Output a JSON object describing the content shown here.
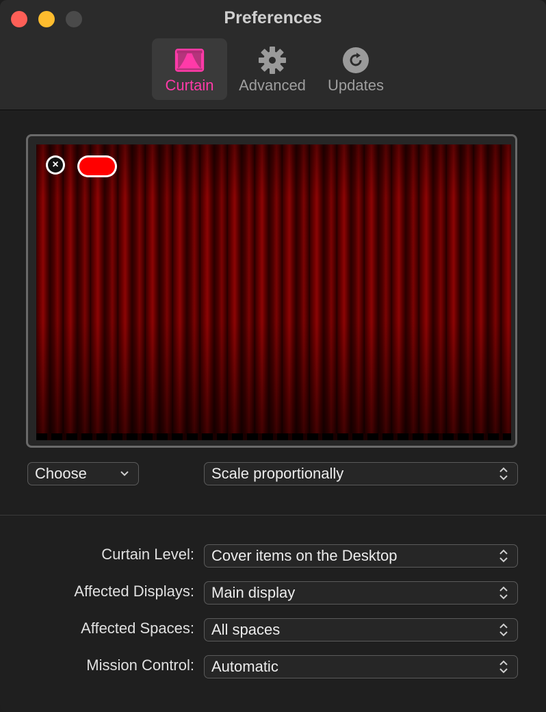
{
  "window": {
    "title": "Preferences"
  },
  "tabs": [
    {
      "label": "Curtain",
      "icon": "curtain-icon",
      "active": true
    },
    {
      "label": "Advanced",
      "icon": "gear-icon",
      "active": false
    },
    {
      "label": "Updates",
      "icon": "refresh-icon",
      "active": false
    }
  ],
  "colors": {
    "accent": "#ff3aa8",
    "curtain_color": "#ff0000"
  },
  "preview": {
    "remove_symbol": "×"
  },
  "image_controls": {
    "choose_label": "Choose",
    "scaling_value": "Scale proportionally"
  },
  "settings": [
    {
      "label": "Curtain Level:",
      "value": "Cover items on the Desktop"
    },
    {
      "label": "Affected Displays:",
      "value": "Main display"
    },
    {
      "label": "Affected Spaces:",
      "value": "All spaces"
    },
    {
      "label": "Mission Control:",
      "value": "Automatic"
    }
  ]
}
